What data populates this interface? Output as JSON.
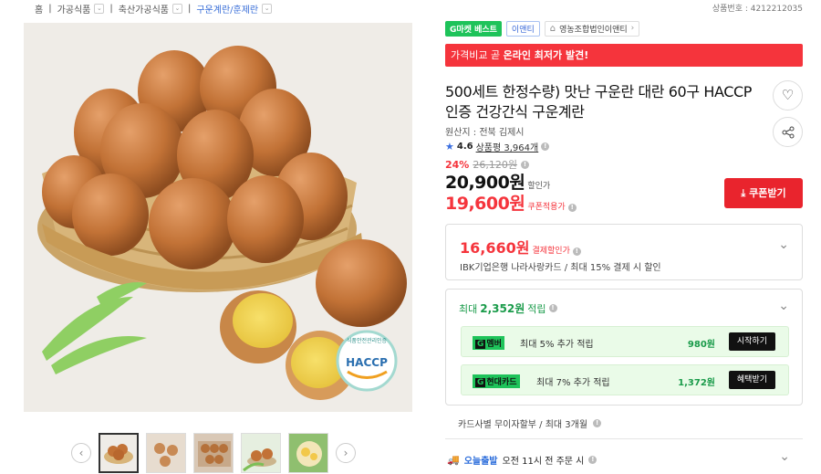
{
  "breadcrumb": {
    "home": "홈",
    "items": [
      "가공식품",
      "축산가공식품",
      "구운계란/훈제란"
    ]
  },
  "product_no": "상품번호 : 4212212035",
  "gallery": {
    "badge_text": "HACCP",
    "badge_small": "식품안전관리인증",
    "prev": "‹",
    "next": "›"
  },
  "badges": {
    "best": "G마켓 베스트",
    "brand": "이앤티",
    "seller": "영농조합법인이앤티"
  },
  "promo": {
    "prefix": "가격비교 곧 ",
    "highlight": "온라인 최저가 발견!"
  },
  "product": {
    "title": "500세트 한정수량) 맛난 구운란 대란 60구 HACCP 인증 건강간식 구운계란",
    "origin": "원산지 : 전북 김제시",
    "rating": "4.6",
    "review_label": "상품평 3,964개",
    "discount_pct": "24%",
    "original_price": "26,120원",
    "price": "20,900원",
    "price_label": "할인가",
    "coupon_price": "19,600원",
    "coupon_label": "쿠폰적용가",
    "coupon_button": "쿠폰받기"
  },
  "payment_discount": {
    "price": "16,660원",
    "label": "결제할인가",
    "detail": "IBK기업은행 나라사랑카드 / 최대 15% 결제 시 할인"
  },
  "reward": {
    "header_prefix": "최대",
    "amount": "2,352원",
    "header_suffix": "적립",
    "rows": [
      {
        "brand": "멤버",
        "text": "최대 5% 추가 적립",
        "amount": "980원",
        "button": "시작하기"
      },
      {
        "brand": "현대카드",
        "text": "최대 7% 추가 적립",
        "amount": "1,372원",
        "button": "혜택받기"
      }
    ]
  },
  "installment": "카드사별 무이자할부 / 최대 3개월",
  "shipping": {
    "label": "오늘출발",
    "detail": "오전 11시 전 주문 시"
  },
  "icons": {
    "heart": "heart-icon",
    "share": "share-icon",
    "star": "star-icon",
    "download": "download-icon",
    "chevron": "chevron-down-icon",
    "truck": "truck-icon"
  },
  "colors": {
    "accent_red": "#f5343c",
    "green": "#1ec35a",
    "blue": "#3b6fe0"
  }
}
